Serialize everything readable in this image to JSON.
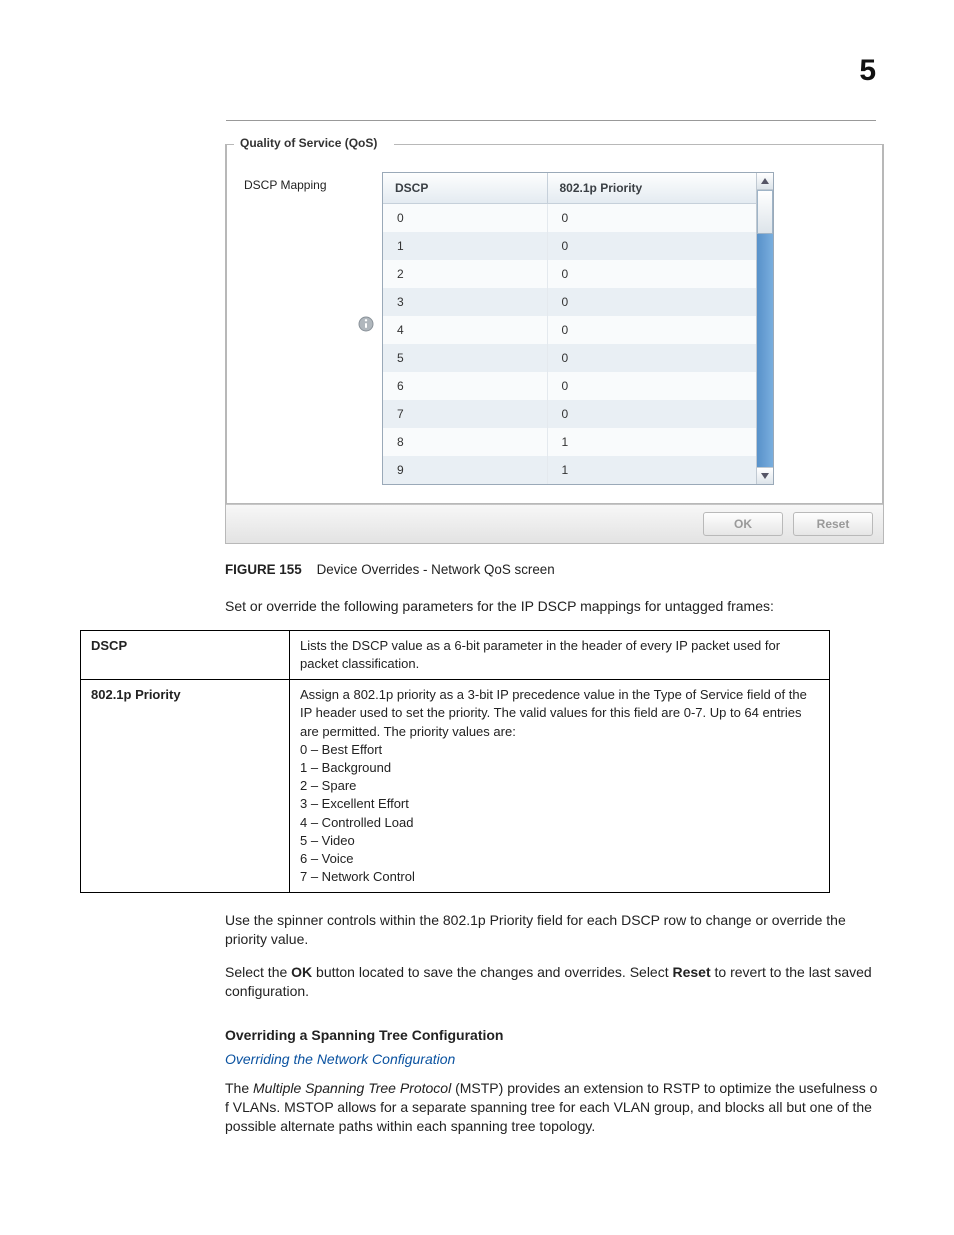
{
  "page_number": "5",
  "qos": {
    "fieldset_legend": "Quality of Service (QoS)",
    "mapping_label": "DSCP Mapping",
    "header_dscp": "DSCP",
    "header_priority": "802.1p Priority",
    "rows": [
      {
        "dscp": "0",
        "priority": "0"
      },
      {
        "dscp": "1",
        "priority": "0"
      },
      {
        "dscp": "2",
        "priority": "0"
      },
      {
        "dscp": "3",
        "priority": "0"
      },
      {
        "dscp": "4",
        "priority": "0"
      },
      {
        "dscp": "5",
        "priority": "0"
      },
      {
        "dscp": "6",
        "priority": "0"
      },
      {
        "dscp": "7",
        "priority": "0"
      },
      {
        "dscp": "8",
        "priority": "1"
      },
      {
        "dscp": "9",
        "priority": "1"
      }
    ],
    "buttons": {
      "ok": "OK",
      "reset": "Reset"
    }
  },
  "figure": {
    "label": "FIGURE 155",
    "caption": "Device Overrides - Network QoS screen"
  },
  "intro_para": "Set or override the following parameters for the IP DSCP mappings for untagged frames:",
  "def_table": {
    "row1": {
      "term": "DSCP",
      "desc": "Lists the DSCP value as a 6-bit parameter in the header of every IP packet used for packet classification."
    },
    "row2": {
      "term": "802.1p Priority",
      "desc_intro": "Assign a 802.1p priority as a 3-bit IP precedence value in the Type of Service field of the IP header used to set the priority. The valid values for this field are 0-7. Up to 64 entries are permitted. The priority values are:",
      "items": [
        "0 – Best Effort",
        "1 – Background",
        "2 – Spare",
        "3 – Excellent Effort",
        "4 – Controlled Load",
        "5 – Video",
        "6 – Voice",
        "7 – Network Control"
      ]
    }
  },
  "spinner_para": "Use the spinner controls within the 802.1p Priority field for each DSCP row to change or override the priority value.",
  "ok_reset_para": {
    "p1": "Select the ",
    "b1": "OK",
    "p2": " button located to save the changes and overrides. Select ",
    "b2": "Reset",
    "p3": " to revert to the last saved configuration."
  },
  "heading_small": "Overriding a Spanning Tree Configuration",
  "xref": "Overriding the Network Configuration",
  "mstp_para": {
    "p1": "The ",
    "i1": "Multiple Spanning Tree Protocol",
    "p2": " (MSTP) provides an extension to RSTP to optimize the usefulness o f VLANs. MSTOP allows for a separate spanning tree for each VLAN group, and blocks all but one of the possible alternate paths within each spanning tree topology."
  }
}
